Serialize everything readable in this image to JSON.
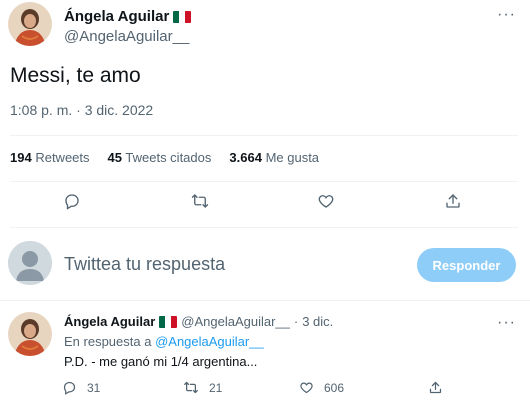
{
  "main_tweet": {
    "author_name": "Ángela Aguilar",
    "author_handle": "@AngelaAguilar__",
    "text": "Messi, te amo",
    "timestamp": "1:08 p. m. · 3 dic. 2022",
    "stats": {
      "retweets_count": "194",
      "retweets_label": "Retweets",
      "quotes_count": "45",
      "quotes_label": "Tweets citados",
      "likes_count": "3.664",
      "likes_label": "Me gusta"
    },
    "actions": [
      "reply-icon",
      "retweet-icon",
      "like-icon",
      "share-icon"
    ]
  },
  "composer": {
    "placeholder": "Twittea tu respuesta",
    "button_label": "Responder"
  },
  "reply_tweet": {
    "author_name": "Ángela Aguilar",
    "author_handle": "@AngelaAguilar__",
    "separator": "·",
    "date": "3 dic.",
    "in_reply_prefix": "En respuesta a",
    "in_reply_mention": "@AngelaAguilar__",
    "text": "P.D. - me ganó mi 1/4 argentina...",
    "reply_count": "31",
    "retweet_count": "21",
    "like_count": "606"
  },
  "colors": {
    "accent": "#1d9bf0",
    "button_disabled": "#8ecdf8",
    "muted_text": "#536471",
    "divider": "#eff3f4"
  }
}
